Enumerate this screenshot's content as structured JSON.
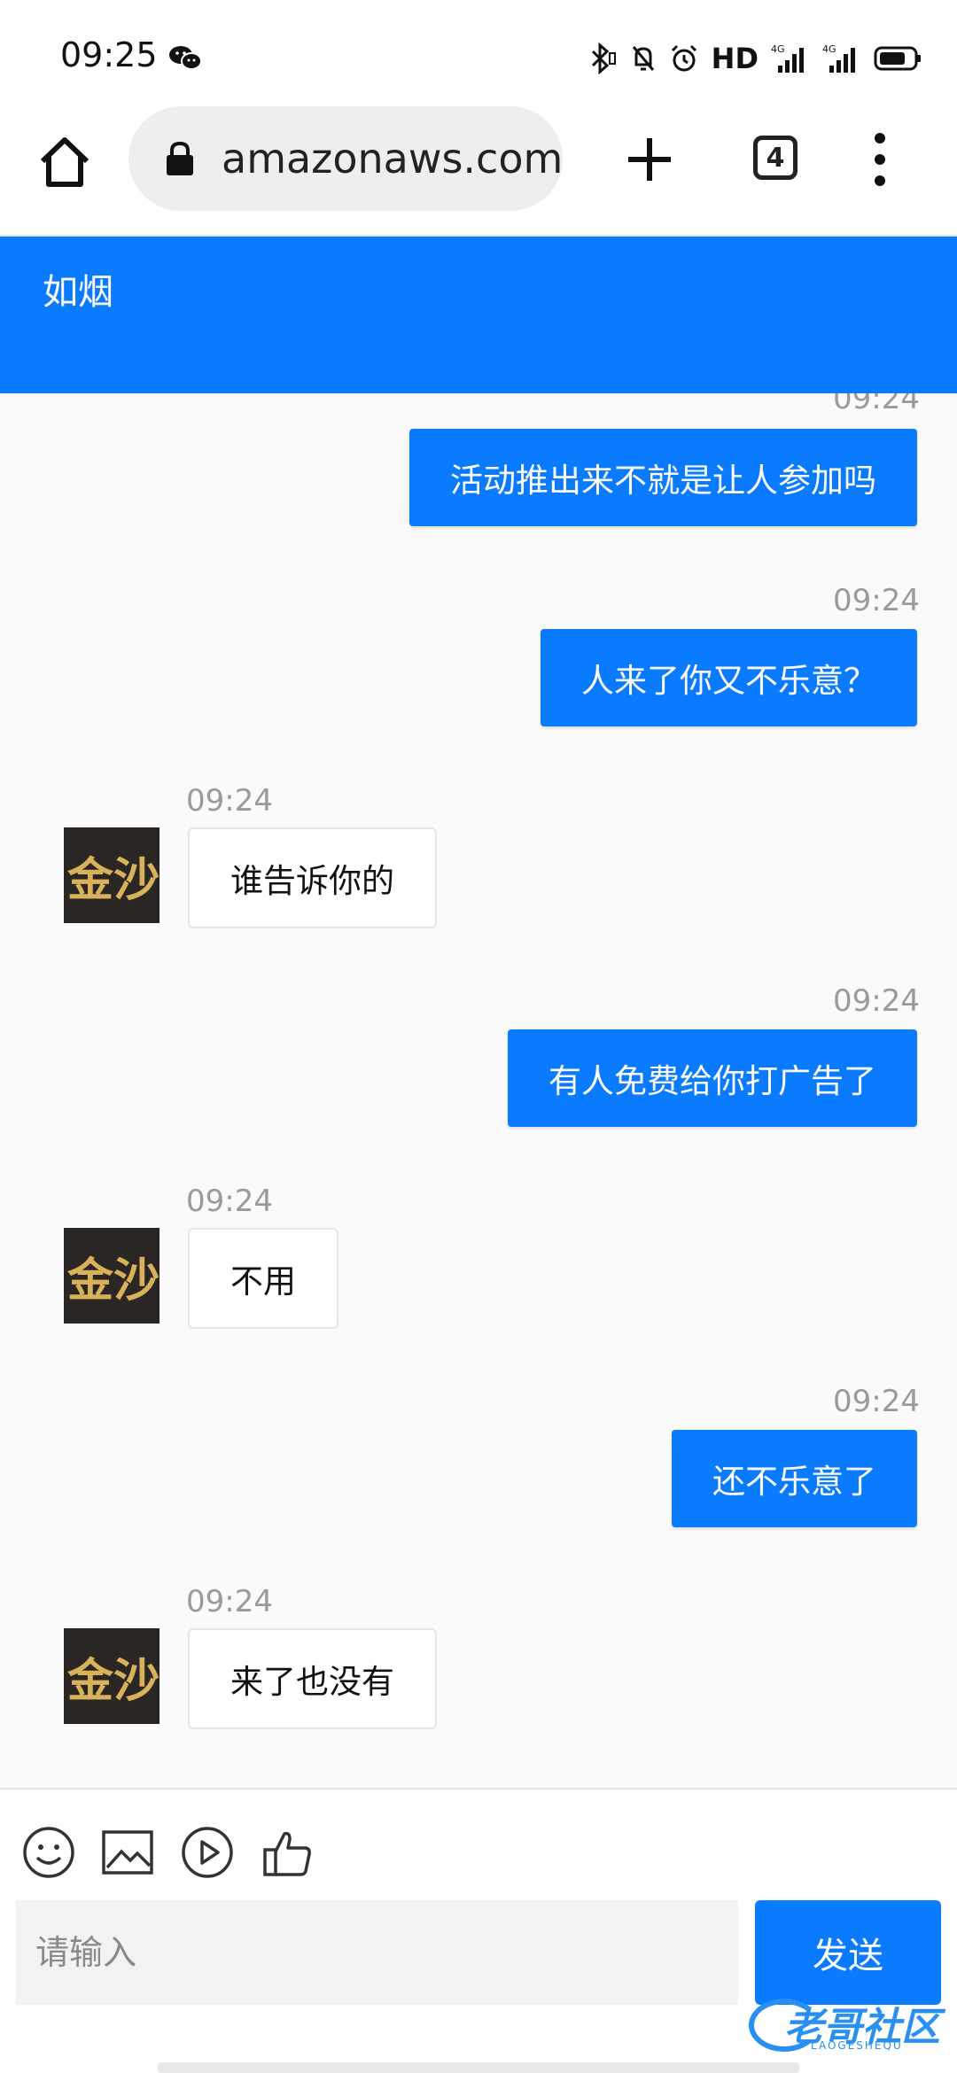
{
  "status": {
    "time": "09:25",
    "hd": "HD",
    "net1": "4G",
    "net2": "4G"
  },
  "browser": {
    "url": "amazonaws.com",
    "tab_count": "4"
  },
  "chat": {
    "title": "如烟"
  },
  "messages": [
    {
      "side": "right",
      "time": "09:24",
      "text": "活动推出来不就是让人参加吗"
    },
    {
      "side": "right",
      "time": "09:24",
      "text": "人来了你又不乐意？"
    },
    {
      "side": "left",
      "time": "09:24",
      "text": "谁告诉你的",
      "avatar_text": "金沙"
    },
    {
      "side": "right",
      "time": "09:24",
      "text": "有人免费给你打广告了"
    },
    {
      "side": "left",
      "time": "09:24",
      "text": "不用",
      "avatar_text": "金沙"
    },
    {
      "side": "right",
      "time": "09:24",
      "text": "还不乐意了"
    },
    {
      "side": "left",
      "time": "09:24",
      "text": "来了也没有",
      "avatar_text": "金沙"
    }
  ],
  "composer": {
    "placeholder": "请输入",
    "send_label": "发送"
  },
  "watermark": {
    "text": "老哥社区",
    "sub": "LAOGESHEQU"
  },
  "colors": {
    "accent": "#0a7bff",
    "background": "#fafafa"
  }
}
